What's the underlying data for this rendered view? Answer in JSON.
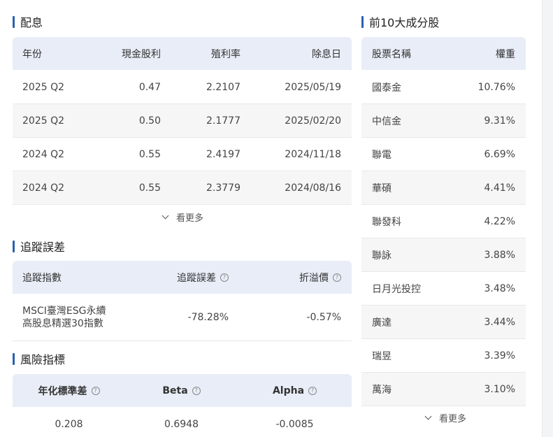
{
  "dividends": {
    "title": "配息",
    "headers": [
      "年份",
      "現金股利",
      "殖利率",
      "除息日"
    ],
    "rows": [
      [
        "2025 Q2",
        "0.47",
        "2.2107",
        "2025/05/19"
      ],
      [
        "2025 Q2",
        "0.50",
        "2.1777",
        "2025/02/20"
      ],
      [
        "2024 Q2",
        "0.55",
        "2.4197",
        "2024/11/18"
      ],
      [
        "2024 Q2",
        "0.55",
        "2.3779",
        "2024/08/16"
      ]
    ],
    "more_label": "看更多"
  },
  "tracking": {
    "title": "追蹤誤差",
    "headers": [
      "追蹤指數",
      "追蹤誤差",
      "折溢價"
    ],
    "index_line1": "MSCI臺灣ESG永續",
    "index_line2": "高股息精選30指數",
    "error": "-78.28%",
    "premium": "-0.57%",
    "help_glyph": "?"
  },
  "risk": {
    "title": "風險指標",
    "headers": [
      "年化標準差",
      "Beta",
      "Alpha"
    ],
    "values": [
      "0.208",
      "0.6948",
      "-0.0085"
    ]
  },
  "holdings": {
    "title": "前10大成分股",
    "headers": [
      "股票名稱",
      "權重"
    ],
    "rows": [
      [
        "國泰金",
        "10.76%"
      ],
      [
        "中信金",
        "9.31%"
      ],
      [
        "聯電",
        "6.69%"
      ],
      [
        "華碩",
        "4.41%"
      ],
      [
        "聯發科",
        "4.22%"
      ],
      [
        "聯詠",
        "3.88%"
      ],
      [
        "日月光投控",
        "3.48%"
      ],
      [
        "廣達",
        "3.44%"
      ],
      [
        "瑞昱",
        "3.39%"
      ],
      [
        "萬海",
        "3.10%"
      ]
    ],
    "more_label": "看更多"
  },
  "colors": {
    "accent": "#2a5fb0",
    "header_bg": "#e8edf7",
    "alt_row": "#f6f6f6"
  }
}
